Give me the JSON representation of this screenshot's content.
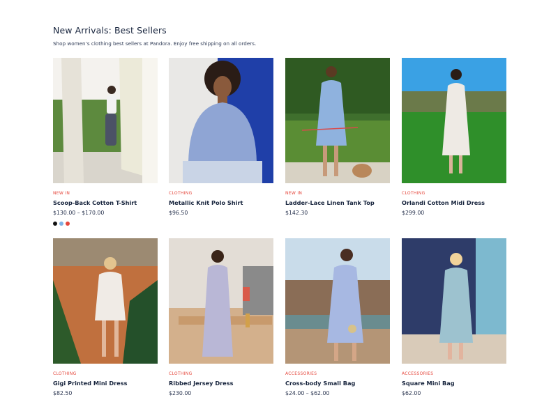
{
  "page": {
    "title": "New Arrivals: Best Sellers",
    "subtitle": "Shop women’s clothing best sellers at Pandora. Enjoy free shipping on all orders."
  },
  "colors": {
    "category": "#e5473c",
    "text": "#17243d"
  },
  "products": [
    {
      "category": "NEW IN",
      "name": "Scoop-Back Cotton T-Shirt",
      "price": "$130.00 – $170.00",
      "swatches": [
        "#111111",
        "#7fb2e5",
        "#e5473c"
      ]
    },
    {
      "category": "CLOTHING",
      "name": "Metallic Knit Polo Shirt",
      "price": "$96.50"
    },
    {
      "category": "NEW IN",
      "name": "Ladder-Lace Linen Tank Top",
      "price": "$142.30"
    },
    {
      "category": "CLOTHING",
      "name": "Orlandi Cotton Midi Dress",
      "price": "$299.00"
    },
    {
      "category": "CLOTHING",
      "name": "Gigi Printed Mini Dress",
      "price": "$82.50"
    },
    {
      "category": "CLOTHING",
      "name": "Ribbed Jersey Dress",
      "price": "$230.00"
    },
    {
      "category": "ACCESSORIES",
      "name": "Cross-body Small Bag",
      "price": "$24.00 – $62.00"
    },
    {
      "category": "ACCESSORIES",
      "name": "Square Mini Bag",
      "price": "$62.00"
    }
  ]
}
